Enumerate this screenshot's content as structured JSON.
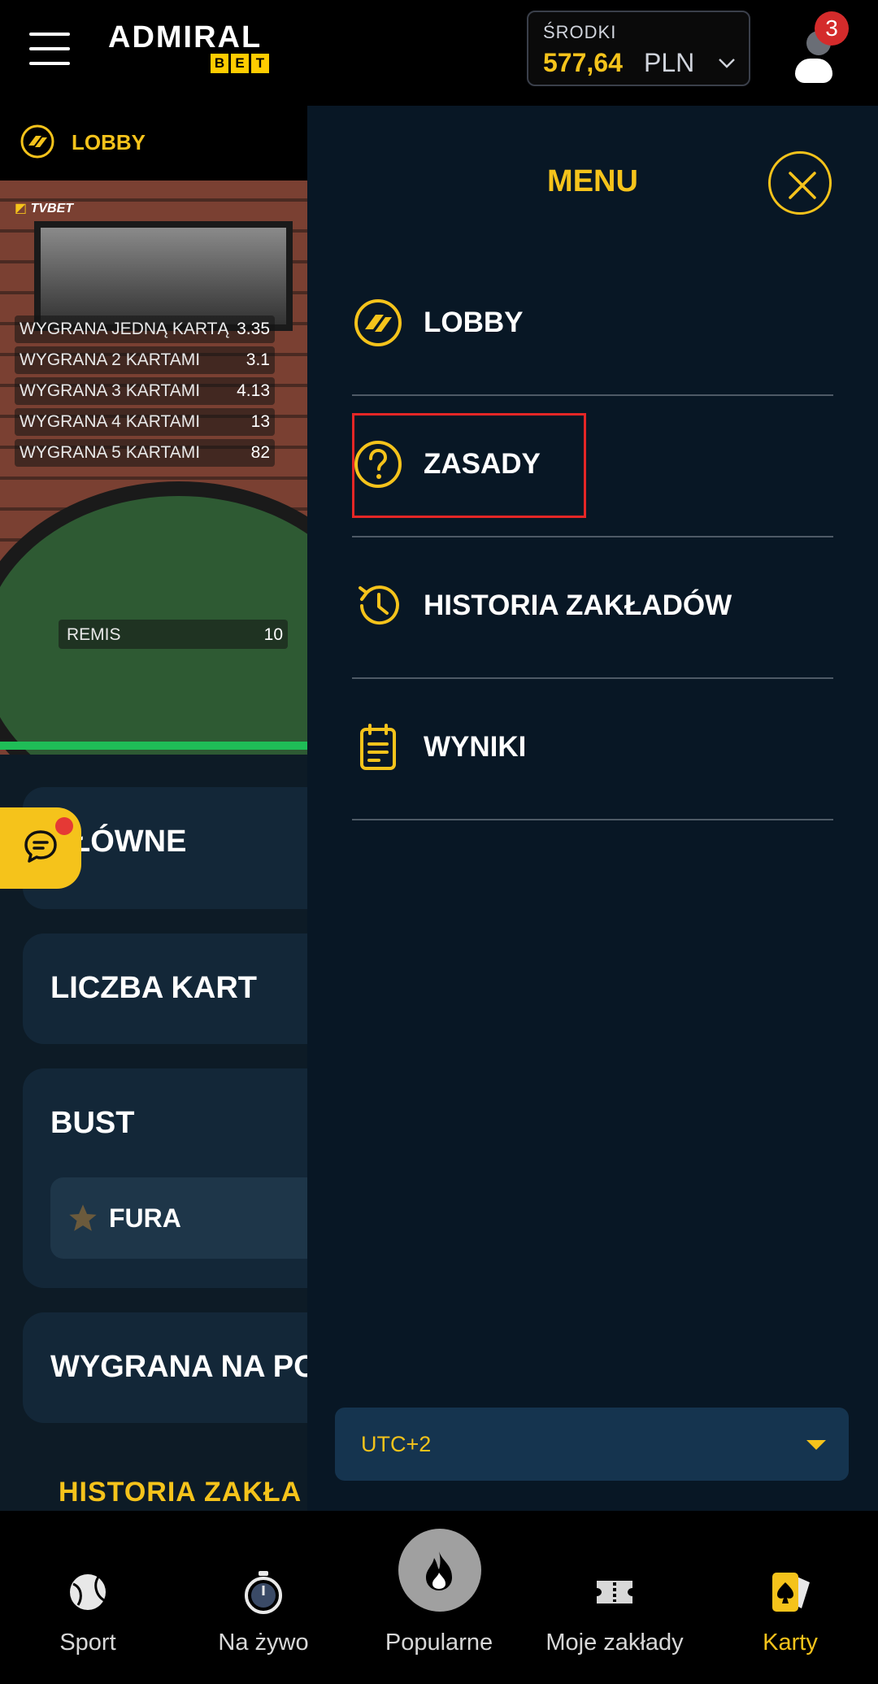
{
  "header": {
    "logo_top": "ADMIRAL",
    "logo_bottom": [
      "B",
      "E",
      "T"
    ],
    "balance_label": "ŚRODKI",
    "balance_amount": "577,64",
    "balance_currency": "PLN",
    "notifications_count": "3"
  },
  "game": {
    "lobby_label": "LOBBY",
    "provider_label": "TVBET",
    "odds": [
      {
        "label": "WYGRANA JEDNĄ KARTĄ",
        "value": "3.35"
      },
      {
        "label": "WYGRANA 2 KARTAMI",
        "value": "3.1"
      },
      {
        "label": "WYGRANA 3 KARTAMI",
        "value": "4.13"
      },
      {
        "label": "WYGRANA 4 KARTAMI",
        "value": "13"
      },
      {
        "label": "WYGRANA 5 KARTAMI",
        "value": "82"
      }
    ],
    "remis": {
      "label": "REMIS",
      "value": "10"
    },
    "sections": {
      "glowne": "ŁÓWNE",
      "liczba_kart": "LICZBA KART",
      "bust": "BUST",
      "fura": "FURA",
      "wygrana_na_po": "WYGRANA NA PO",
      "historia": "HISTORIA ZAKŁA"
    }
  },
  "menu": {
    "title": "MENU",
    "items": [
      {
        "label": "LOBBY",
        "icon": "lobby-icon"
      },
      {
        "label": "ZASADY",
        "icon": "question-circle-icon"
      },
      {
        "label": "HISTORIA ZAKŁADÓW",
        "icon": "history-icon"
      },
      {
        "label": "WYNIKI",
        "icon": "clipboard-icon"
      }
    ],
    "timezone": "UTC+2"
  },
  "bottom_nav": [
    {
      "label": "Sport",
      "icon": "ball-icon"
    },
    {
      "label": "Na żywo",
      "icon": "stopwatch-icon"
    },
    {
      "label": "Popularne",
      "icon": "flame-icon"
    },
    {
      "label": "Moje zakłady",
      "icon": "ticket-icon"
    },
    {
      "label": "Karty",
      "icon": "cards-icon",
      "active": true
    }
  ],
  "colors": {
    "accent": "#f5c31b",
    "drawer_bg": "#081725",
    "highlight": "#e52626",
    "progress": "#1fbd57"
  }
}
